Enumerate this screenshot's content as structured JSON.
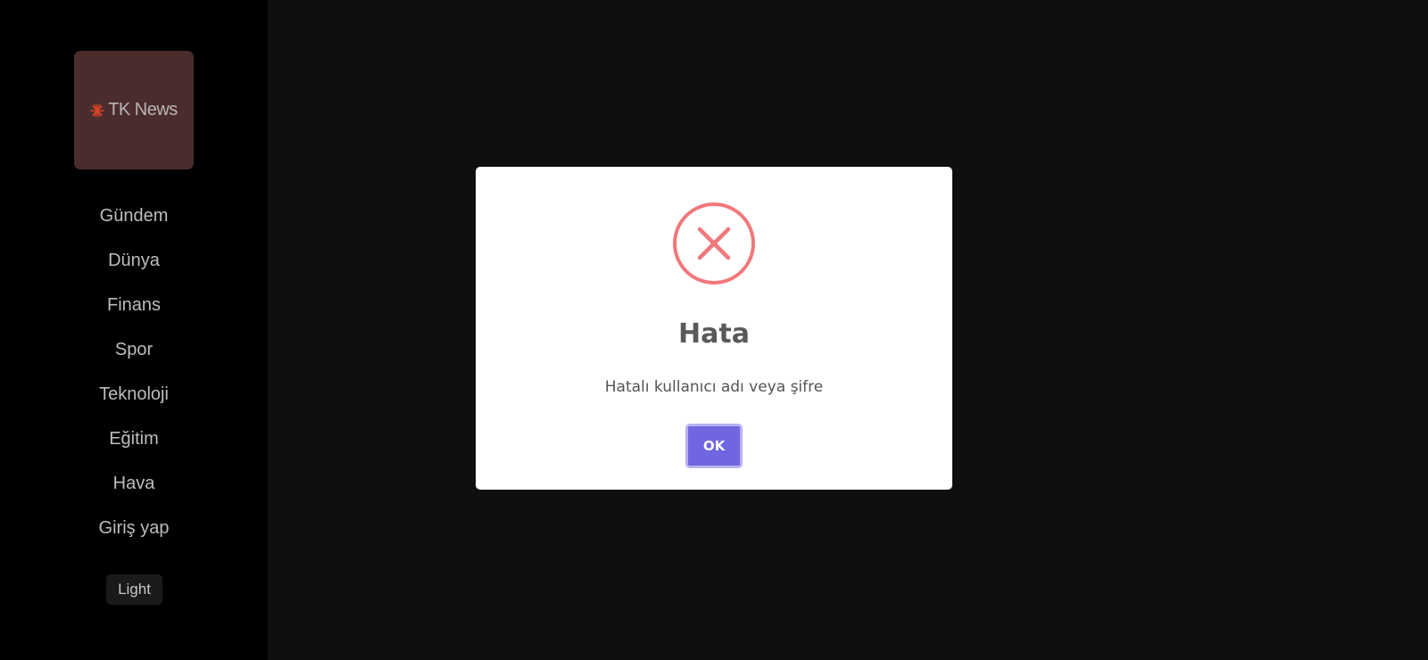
{
  "sidebar": {
    "logo": {
      "text": "TK News",
      "mark_color": "#d9442a",
      "icon": "tk-news-logo-icon"
    },
    "nav_items": [
      {
        "label": "Gündem"
      },
      {
        "label": "Dünya"
      },
      {
        "label": "Finans"
      },
      {
        "label": "Spor"
      },
      {
        "label": "Teknoloji"
      },
      {
        "label": "Eğitim"
      },
      {
        "label": "Hava"
      },
      {
        "label": "Giriş yap"
      }
    ],
    "theme_toggle_label": "Light"
  },
  "modal": {
    "icon": "error-x-icon",
    "icon_color": "#f0787b",
    "title": "Hata",
    "message": "Hatalı kullanıcı adı veya şifre",
    "ok_label": "OK",
    "ok_color": "#7066e0"
  }
}
